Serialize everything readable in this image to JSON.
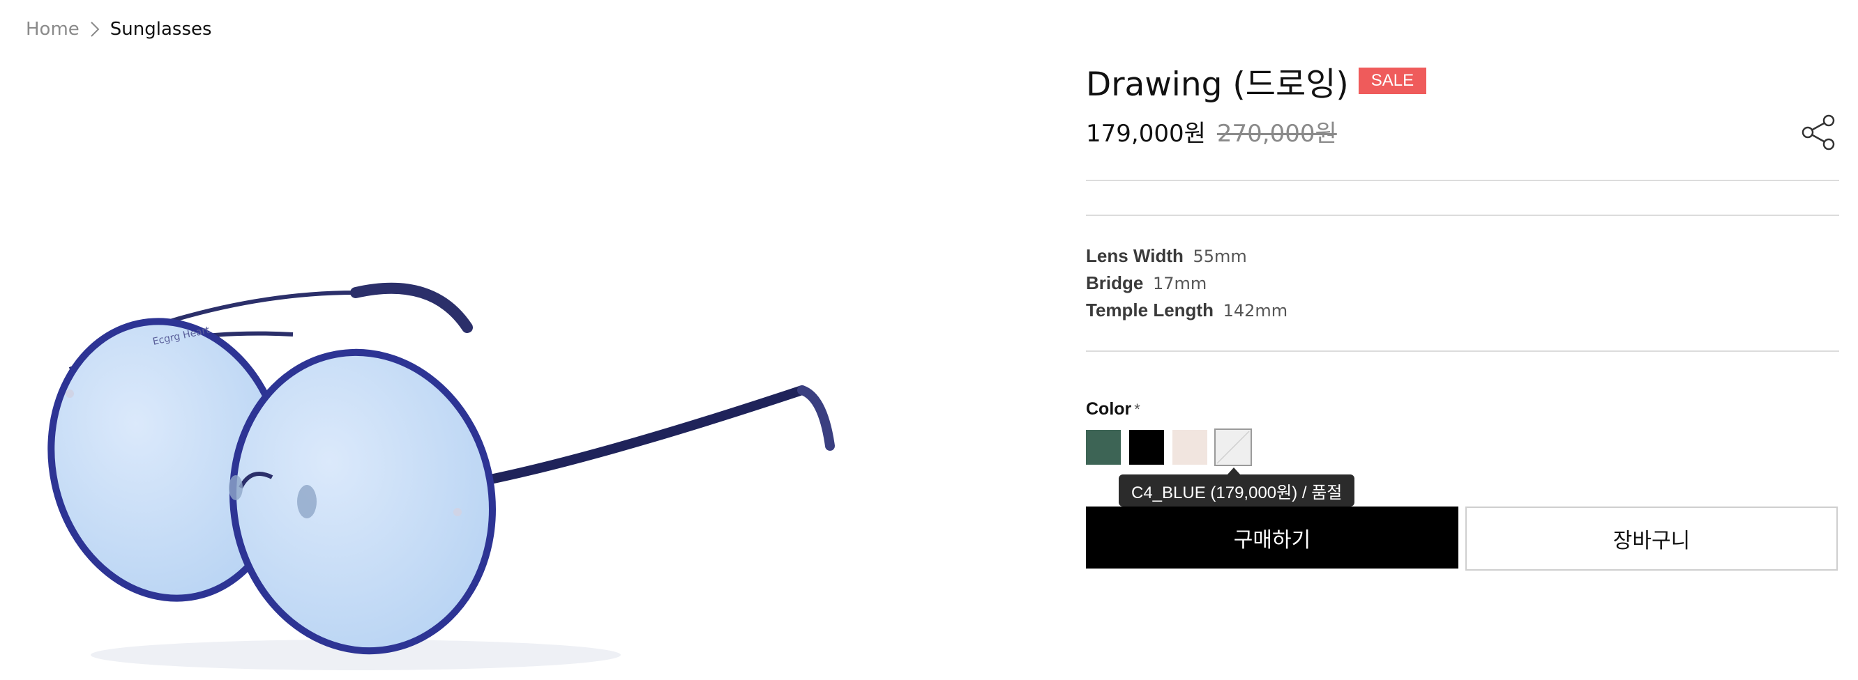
{
  "breadcrumb": {
    "home": "Home",
    "current": "Sunglasses"
  },
  "product": {
    "image_alt": "sunglasses-product-photo",
    "title": "Drawing (드로잉)",
    "sale_badge": "SALE",
    "price_current": "179,000원",
    "price_original": "270,000원",
    "frame_text": "Ecgrg Heart"
  },
  "specs": [
    {
      "label": "Lens Width",
      "value": "55mm"
    },
    {
      "label": "Bridge",
      "value": "17mm"
    },
    {
      "label": "Temple Length",
      "value": "142mm"
    }
  ],
  "color_option": {
    "label": "Color",
    "required_mark": "*",
    "swatches": [
      {
        "name": "green",
        "color": "#3d6455"
      },
      {
        "name": "black",
        "color": "#000000"
      },
      {
        "name": "beige",
        "color": "#f1e5df"
      },
      {
        "name": "clear",
        "color": "#efefef"
      }
    ],
    "selected_index": 3,
    "tooltip": "C4_BLUE (179,000원) / 품절"
  },
  "actions": {
    "buy_label": "구매하기",
    "cart_label": "장바구니"
  },
  "icons": {
    "breadcrumb_separator": "chevron-right-icon",
    "share": "share-icon"
  },
  "colors": {
    "sale": "#ef5b5b",
    "buy_button": "#000000",
    "tooltip_bg": "#2b2b2b",
    "divider": "#dcdcdc"
  }
}
